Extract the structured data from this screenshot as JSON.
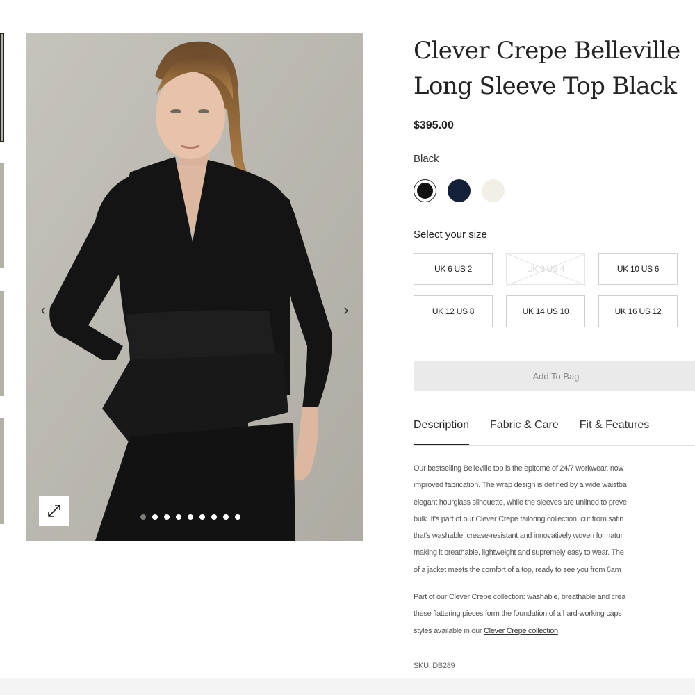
{
  "gallery": {
    "prev_arrow": "‹",
    "next_arrow": "›",
    "dot_count": 9,
    "active_dot": 0
  },
  "product": {
    "title_line1": "Clever Crepe Belleville",
    "title_line2": "Long Sleeve Top Black",
    "price": "$395.00",
    "color_name": "Black",
    "swatches": [
      {
        "name": "Black",
        "color": "#111111",
        "selected": true
      },
      {
        "name": "Navy",
        "color": "#15203a",
        "selected": false
      },
      {
        "name": "Ivory",
        "color": "#f1efe6",
        "selected": false
      }
    ],
    "size_heading": "Select your size",
    "sizes": [
      {
        "label": "UK 6 US 2",
        "available": true
      },
      {
        "label": "UK 8 US 4",
        "available": false
      },
      {
        "label": "UK 10 US 6",
        "available": true
      },
      {
        "label": "UK 12 US 8",
        "available": true
      },
      {
        "label": "UK 14 US 10",
        "available": true
      },
      {
        "label": "UK 16 US 12",
        "available": true
      }
    ],
    "add_to_bag": "Add To Bag"
  },
  "tabs": [
    {
      "label": "Description",
      "active": true
    },
    {
      "label": "Fabric & Care",
      "active": false
    },
    {
      "label": "Fit & Features",
      "active": false
    }
  ],
  "description": {
    "para1_lines": [
      "Our bestselling Belleville top is the epitome of 24/7 workwear, now",
      "improved fabrication. The wrap design is defined by a wide waistba",
      "elegant hourglass silhouette, while the sleeves are unlined to preve",
      "bulk. It's part of our Clever Crepe tailoring collection, cut from satin",
      "that's washable, crease-resistant and innovatively woven for natur",
      "making it breathable, lightweight and supremely easy to wear. The",
      "of a jacket meets the comfort of a top, ready to see you from 6am"
    ],
    "para2_lines": [
      "Part of our Clever Crepe collection: washable, breathable and crea",
      "these flattering pieces form the foundation of a hard-working caps"
    ],
    "para2_last_prefix": "styles available in our ",
    "para2_link": "Clever Crepe collection",
    "para2_last_suffix": ".",
    "sku": "SKU: DB289"
  },
  "colors": {
    "accent": "#222222",
    "button_bg": "#eaeaea",
    "image_bg": "#bdbab3"
  }
}
